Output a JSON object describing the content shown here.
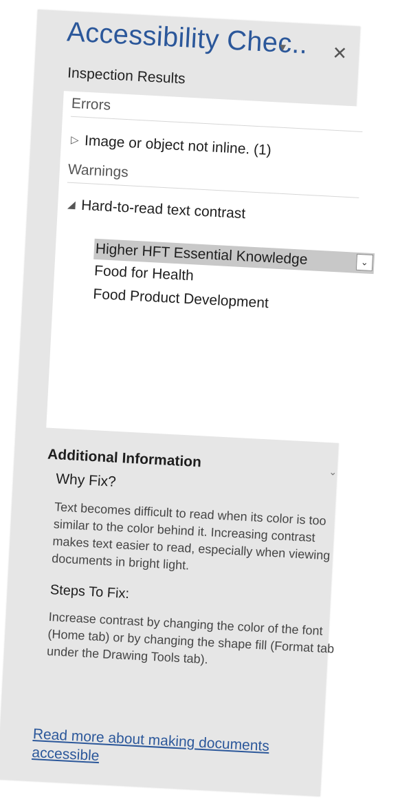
{
  "header": {
    "title": "Accessibility Chec..",
    "dropdown_icon": "caret-down-icon",
    "close_icon": "close-icon"
  },
  "inspection": {
    "label": "Inspection Results",
    "errors": {
      "header": "Errors",
      "items": [
        {
          "label": "Image or object not inline. (1)",
          "expanded": false
        }
      ]
    },
    "warnings": {
      "header": "Warnings",
      "group": {
        "label": "Hard-to-read text contrast",
        "expanded": true,
        "items": [
          {
            "label": "Higher HFT Essential Knowledge",
            "selected": true
          },
          {
            "label": "Food for Health",
            "selected": false
          },
          {
            "label": "Food Product Development",
            "selected": false
          }
        ]
      }
    }
  },
  "additional": {
    "header": "Additional Information",
    "why_title": "Why Fix?",
    "why_text": "Text becomes difficult to read when its color is too similar to the color behind it. Increasing contrast makes text easier to read, especially when viewing documents in bright light.",
    "steps_title": "Steps To Fix:",
    "steps_text": "Increase contrast by changing the color of the font (Home tab) or by changing the shape fill (Format tab under the Drawing Tools tab)."
  },
  "footer": {
    "link": "Read more about making documents accessible"
  },
  "colors": {
    "accent": "#2b579a",
    "panel_bg": "#e6e6e6",
    "selection": "#c8c8c8"
  }
}
